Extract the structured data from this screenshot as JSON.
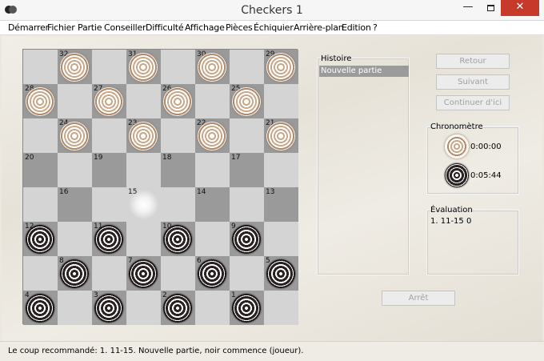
{
  "window": {
    "title": "Checkers 1",
    "minimize": "—",
    "close": "✕"
  },
  "menu": [
    "Démarrer",
    "Fichier",
    "Partie",
    "Conseiller",
    "Difficulté",
    "Affichage",
    "Pièces",
    "Échiquier",
    "Arrière-plan",
    "Edition",
    "?"
  ],
  "board": {
    "square_numbers": [
      "32",
      "31",
      "30",
      "29",
      "28",
      "27",
      "26",
      "25",
      "24",
      "23",
      "22",
      "21",
      "20",
      "19",
      "18",
      "17",
      "16",
      "15",
      "14",
      "13",
      "12",
      "11",
      "10",
      "9",
      "8",
      "7",
      "6",
      "5",
      "4",
      "3",
      "2",
      "1"
    ],
    "white_pieces_on": [
      21,
      22,
      23,
      24,
      25,
      26,
      27,
      28,
      29,
      30,
      31,
      32
    ],
    "black_pieces_on": [
      1,
      2,
      3,
      4,
      5,
      6,
      7,
      8,
      9,
      10,
      11,
      12
    ],
    "highlighted_square": 15
  },
  "history": {
    "label": "Histoire",
    "items": [
      "Nouvelle partie"
    ]
  },
  "buttons": {
    "back": "Retour",
    "next": "Suivant",
    "continue": "Continuer d'ici",
    "stop": "Arrêt"
  },
  "timer": {
    "label": "Chronomètre",
    "white_time": "0:00:00",
    "black_time": "0:05:44"
  },
  "evaluation": {
    "label": "Évaluation",
    "text": "1.  11-15 0"
  },
  "status": "Le coup recommandé: 1. 11-15.  Nouvelle partie, noir commence (joueur)."
}
